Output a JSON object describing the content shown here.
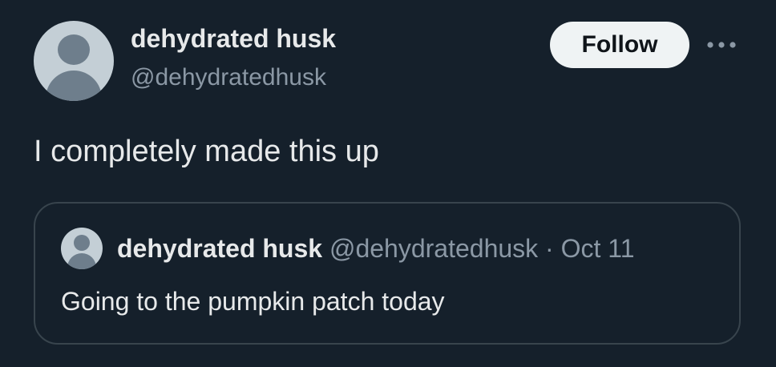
{
  "tweet": {
    "author": {
      "display_name": "dehydrated husk",
      "handle": "@dehydratedhusk"
    },
    "follow_label": "Follow",
    "more_icon": "more-horizontal-icon",
    "text": "I completely made this up",
    "quoted": {
      "display_name": "dehydrated husk",
      "handle": "@dehydratedhusk",
      "separator": "·",
      "date": "Oct 11",
      "text": "Going to the pumpkin patch today"
    }
  },
  "colors": {
    "background": "#15202b",
    "primary_text": "#e7e9ea",
    "secondary_text": "#8b98a5",
    "border": "#38444d",
    "follow_bg": "#eff3f4",
    "avatar_bg": "#c4cfd6",
    "avatar_fg": "#6e7e8c"
  }
}
